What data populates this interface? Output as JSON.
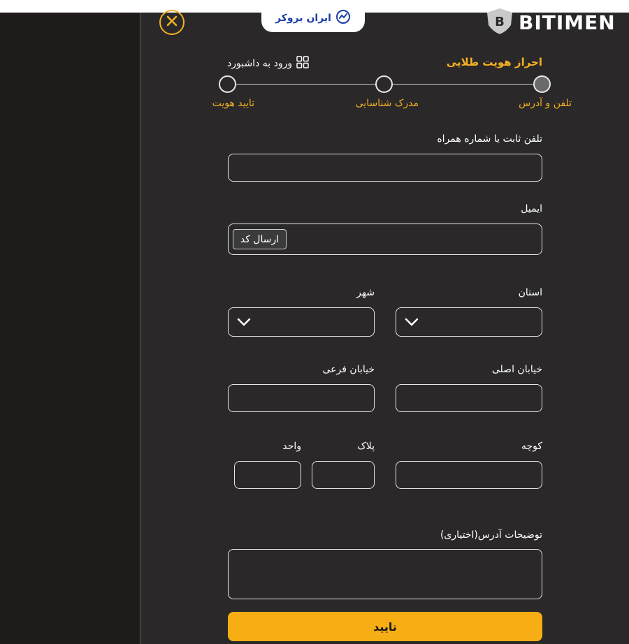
{
  "header": {
    "brand": "BITIMEN",
    "partner_tab": "ایران بروکر",
    "close_icon": "close-x-icon"
  },
  "page": {
    "title": "احراز هویت طلایی",
    "dashboard_link": "ورود به داشبورد"
  },
  "steps": [
    {
      "label": "تلفن و آدرس",
      "active": true
    },
    {
      "label": "مدرک شناسایی",
      "active": false
    },
    {
      "label": "تایید هویت",
      "active": false
    }
  ],
  "form": {
    "phone_label": "تلفن ثابت یا شماره همراه",
    "phone_value": "",
    "email_label": "ایمیل",
    "email_value": "",
    "send_code": "ارسال کد",
    "province_label": "استان",
    "city_label": "شهر",
    "main_street_label": "خیابان اصلی",
    "side_street_label": "خیابان فرعی",
    "alley_label": "کوچه",
    "plate_label": "پلاک",
    "unit_label": "واحد",
    "address_desc_label": "توضیحات آدرس(اختیاری)",
    "submit": "تایید"
  },
  "colors": {
    "accent": "#f3b123",
    "button": "#f7ad14",
    "panel": "#2a2828",
    "background": "#201e1e"
  }
}
